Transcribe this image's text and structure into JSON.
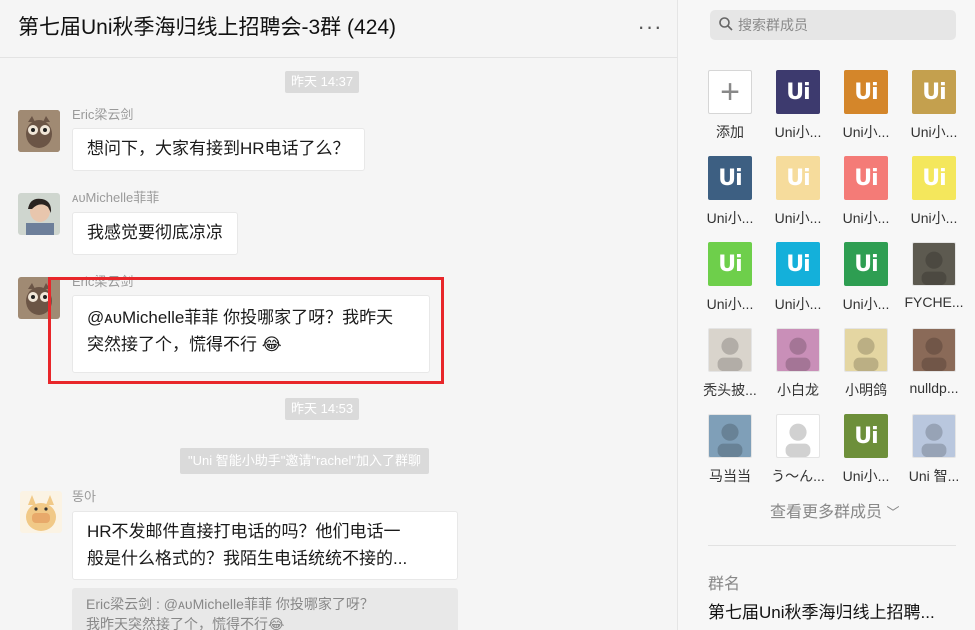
{
  "chat": {
    "title": "第七届Uni秋季海归线上招聘会-3群 (424)",
    "more_icon": "more-horizontal-icon"
  },
  "messages": [
    {
      "type": "time",
      "text": "昨天 14:37"
    },
    {
      "type": "msg",
      "sender": "Eric梁云剑",
      "text": "想问下，大家有接到HR电话了么？"
    },
    {
      "type": "msg",
      "sender": "ᴀᴜMichelle菲菲",
      "text": "我感觉要彻底凉凉"
    },
    {
      "type": "msg",
      "sender": "Eric梁云剑",
      "line1": "@ᴀᴜMichelle菲菲 你投哪家了呀？我昨天",
      "line2": "突然接了个，慌得不行",
      "emoji": "😂"
    },
    {
      "type": "time",
      "text": "昨天 14:53"
    },
    {
      "type": "system",
      "text": "\"Uni 智能小助手\"邀请\"rachel\"加入了群聊"
    },
    {
      "type": "msg",
      "sender": "똥아",
      "line1": "HR不发邮件直接打电话的吗？他们电话一",
      "line2": "般是什么格式的？我陌生电话统统不接的..."
    },
    {
      "type": "quote",
      "line1": "Eric梁云剑 : @ᴀᴜMichelle菲菲 你投哪家了呀？",
      "line2": "我昨天突然接了个，慌得不行",
      "emoji": "😂"
    }
  ],
  "sidebar": {
    "search_placeholder": "搜索群成员",
    "members": [
      {
        "name": "添加",
        "kind": "add"
      },
      {
        "name": "Uni小...",
        "kind": "uni",
        "color": "#3d3a6e"
      },
      {
        "name": "Uni小...",
        "kind": "uni",
        "color": "#d4862a"
      },
      {
        "name": "Uni小...",
        "kind": "uni",
        "color": "#c4a04e"
      },
      {
        "name": "Uni小...",
        "kind": "uni",
        "color": "#3d5f82"
      },
      {
        "name": "Uni小...",
        "kind": "uni",
        "color": "#f6dc9c"
      },
      {
        "name": "Uni小...",
        "kind": "uni",
        "color": "#f47b77"
      },
      {
        "name": "Uni小...",
        "kind": "uni",
        "color": "#f4e75c"
      },
      {
        "name": "Uni小...",
        "kind": "uni",
        "color": "#6ecf4b"
      },
      {
        "name": "Uni小...",
        "kind": "uni",
        "color": "#14b0da"
      },
      {
        "name": "Uni小...",
        "kind": "uni",
        "color": "#2e9e52"
      },
      {
        "name": "FYCHE...",
        "kind": "photo",
        "color": "#5d5a50"
      },
      {
        "name": "秃头披...",
        "kind": "photo",
        "color": "#d9d4cc"
      },
      {
        "name": "小白龙",
        "kind": "photo",
        "color": "#c98fb8"
      },
      {
        "name": "小明鸽",
        "kind": "photo",
        "color": "#e4d6a2"
      },
      {
        "name": "nulldp...",
        "kind": "photo",
        "color": "#8a6a58"
      },
      {
        "name": "马当当",
        "kind": "photo",
        "color": "#7f9fb8"
      },
      {
        "name": "う～ん...",
        "kind": "photo",
        "color": "#ffffff"
      },
      {
        "name": "Uni小...",
        "kind": "uni",
        "color": "#6d8f3a"
      },
      {
        "name": "Uni 智...",
        "kind": "photo",
        "color": "#b9c7de"
      }
    ],
    "more_members": "查看更多群成员",
    "group_label": "群名",
    "group_name": "第七届Uni秋季海归线上招聘..."
  }
}
